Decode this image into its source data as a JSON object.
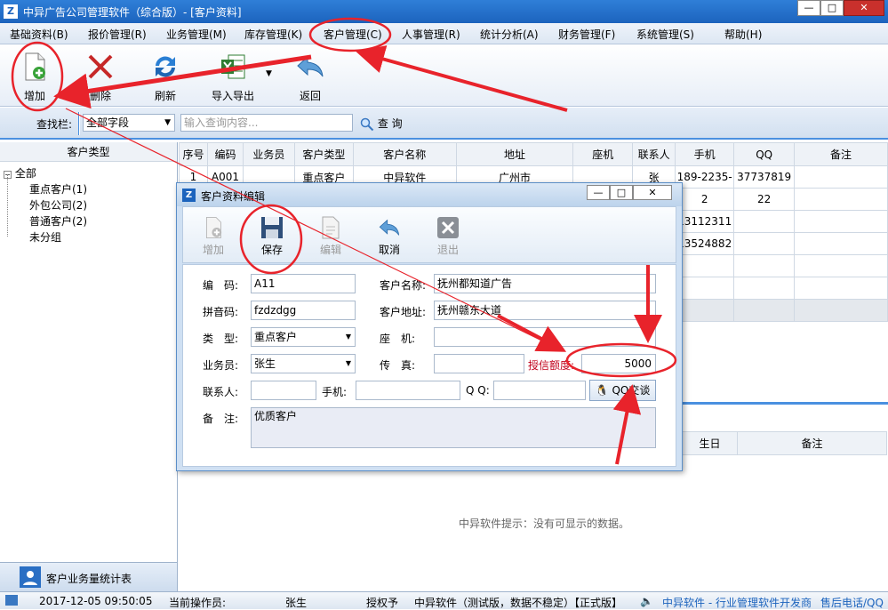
{
  "window": {
    "title": "中异广告公司管理软件（综合版）- [客户资料]",
    "logo_text": "Z"
  },
  "menu": [
    "基础资料(B)",
    "报价管理(R)",
    "业务管理(M)",
    "库存管理(K)",
    "客户管理(C)",
    "人事管理(R)",
    "统计分析(A)",
    "财务管理(F)",
    "系统管理(S)",
    "帮助(H)"
  ],
  "toolbar": {
    "add": "增加",
    "delete": "删除",
    "refresh": "刷新",
    "import_export": "导入导出",
    "back": "返回"
  },
  "search": {
    "label": "查找栏:",
    "field": "全部字段",
    "placeholder": "输入查询内容...",
    "button": "查 询"
  },
  "left": {
    "header": "客户类型",
    "tree_root": "全部",
    "tree_items": [
      "重点客户(1)",
      "外包公司(2)",
      "普通客户(2)",
      "未分组"
    ],
    "footer_button": "客户业务量统计表"
  },
  "grid": {
    "columns": [
      "序号",
      "编码",
      "业务员",
      "客户类型",
      "客户名称",
      "地址",
      "座机",
      "联系人",
      "手机",
      "QQ",
      "备注"
    ],
    "rows": [
      [
        "1",
        "A001",
        "",
        "重点客户",
        "中异软件",
        "广州市",
        "",
        "张",
        "189-2235-",
        "37737819",
        ""
      ],
      [
        "",
        "",
        "",
        "",
        "",
        "",
        "",
        "",
        "2",
        "22",
        ""
      ],
      [
        "",
        "",
        "",
        "",
        "",
        "",
        "",
        "",
        "13112311",
        "",
        ""
      ],
      [
        "",
        "",
        "",
        "",
        "",
        "",
        "",
        "",
        "13524882",
        "",
        ""
      ]
    ],
    "sub_columns": [
      "生日",
      "备注"
    ],
    "empty_message": "中异软件提示：没有可显示的数据。"
  },
  "dialog": {
    "title": "客户资料编辑",
    "tools": {
      "add": "增加",
      "save": "保存",
      "edit": "编辑",
      "cancel": "取消",
      "exit": "退出"
    },
    "labels": {
      "code": "编　码:",
      "pinyin": "拼音码:",
      "type": "类　型:",
      "salesman": "业务员:",
      "contact": "联系人:",
      "phone": "手机:",
      "qq": "Q Q:",
      "note": "备　注:",
      "name": "客户名称:",
      "address": "客户地址:",
      "landline": "座　机:",
      "fax": "传　真:",
      "credit": "授信额度:"
    },
    "values": {
      "code": "A11",
      "pinyin": "fzdzdgg",
      "type": "重点客户",
      "salesman": "张生",
      "name": "抚州都知道广告",
      "address": "抚州赣东大道",
      "credit": "5000",
      "note": "优质客户",
      "qq_button": "QQ交谈"
    }
  },
  "status": {
    "datetime": "2017-12-05 09:50:05",
    "operator_label": "当前操作员:",
    "operator": "张生",
    "license": "授权予",
    "version": "中异软件（测试版，数据不稳定）【正式版】",
    "company": "中异软件 - 行业管理软件开发商",
    "hotline": "售后电话/QQ"
  },
  "colors": {
    "accent": "#1c63bd",
    "annotation": "#e8232b",
    "credit_label": "#c0001a"
  }
}
